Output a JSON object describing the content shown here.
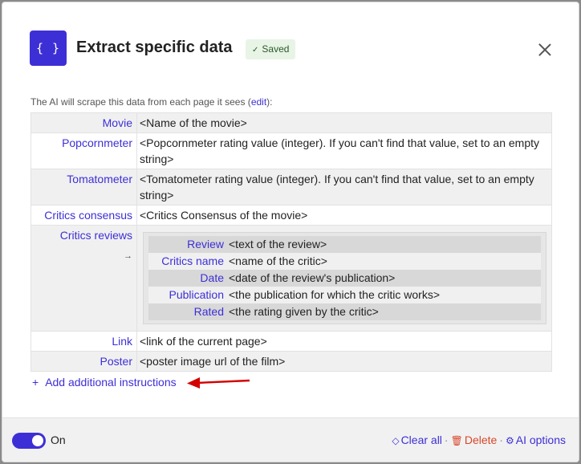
{
  "header": {
    "logo": "{ }",
    "title": "Extract specific data",
    "saved_label": "Saved",
    "saved_icon": "✓"
  },
  "intro": {
    "text": "The AI will scrape this data from each page it sees (",
    "edit_link": "edit",
    "text_end": "):"
  },
  "fields": [
    {
      "key": "Movie",
      "value": "<Name of the movie>"
    },
    {
      "key": "Popcornmeter",
      "value": "<Popcornmeter rating value (integer). If you can't find that value, set to an empty string>"
    },
    {
      "key": "Tomatometer",
      "value": "<Tomatometer rating value (integer). If you can't find that value, set to an empty string>"
    },
    {
      "key": "Critics consensus",
      "value": "<Critics Consensus of the movie>"
    },
    {
      "key": "Critics reviews",
      "arrow": "→"
    },
    {
      "key": "Link",
      "value": "<link of the current page>"
    },
    {
      "key": "Poster",
      "value": "<poster image url of the film>"
    }
  ],
  "critics_reviews": [
    {
      "key": "Review",
      "value": "<text of the review>"
    },
    {
      "key": "Critics name",
      "value": "<name of the critic>"
    },
    {
      "key": "Date",
      "value": "<date of the review's publication>"
    },
    {
      "key": "Publication",
      "value": "<the publication for which the critic works>"
    },
    {
      "key": "Rated",
      "value": "<the rating given by the critic>"
    }
  ],
  "add_instructions": {
    "icon": "+",
    "label": "Add additional instructions"
  },
  "footer": {
    "toggle_label": "On",
    "clear_label": "Clear all",
    "delete_label": "Delete",
    "ai_label": "AI options",
    "separator": "·"
  },
  "colors": {
    "accent": "#3d2fd6",
    "danger": "#d9472b",
    "annotation": "#d40000"
  }
}
